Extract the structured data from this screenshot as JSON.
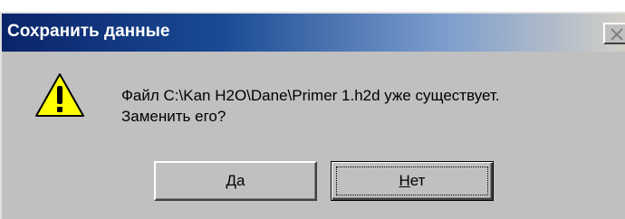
{
  "dialog": {
    "title": "Сохранить данные",
    "message_line1": "Файл C:\\Kan H2O\\Dane\\Primer 1.h2d уже существует.",
    "message_line2": "Заменить его?",
    "icon": "warning-icon"
  },
  "buttons": {
    "yes_mnemonic": "Д",
    "yes_rest": "а",
    "no_mnemonic": "Н",
    "no_rest": "ет"
  },
  "colors": {
    "titlebar_start": "#0a246a",
    "titlebar_end": "#d4d0c8",
    "face": "#c0c0c0",
    "warning_yellow": "#ffff00"
  }
}
